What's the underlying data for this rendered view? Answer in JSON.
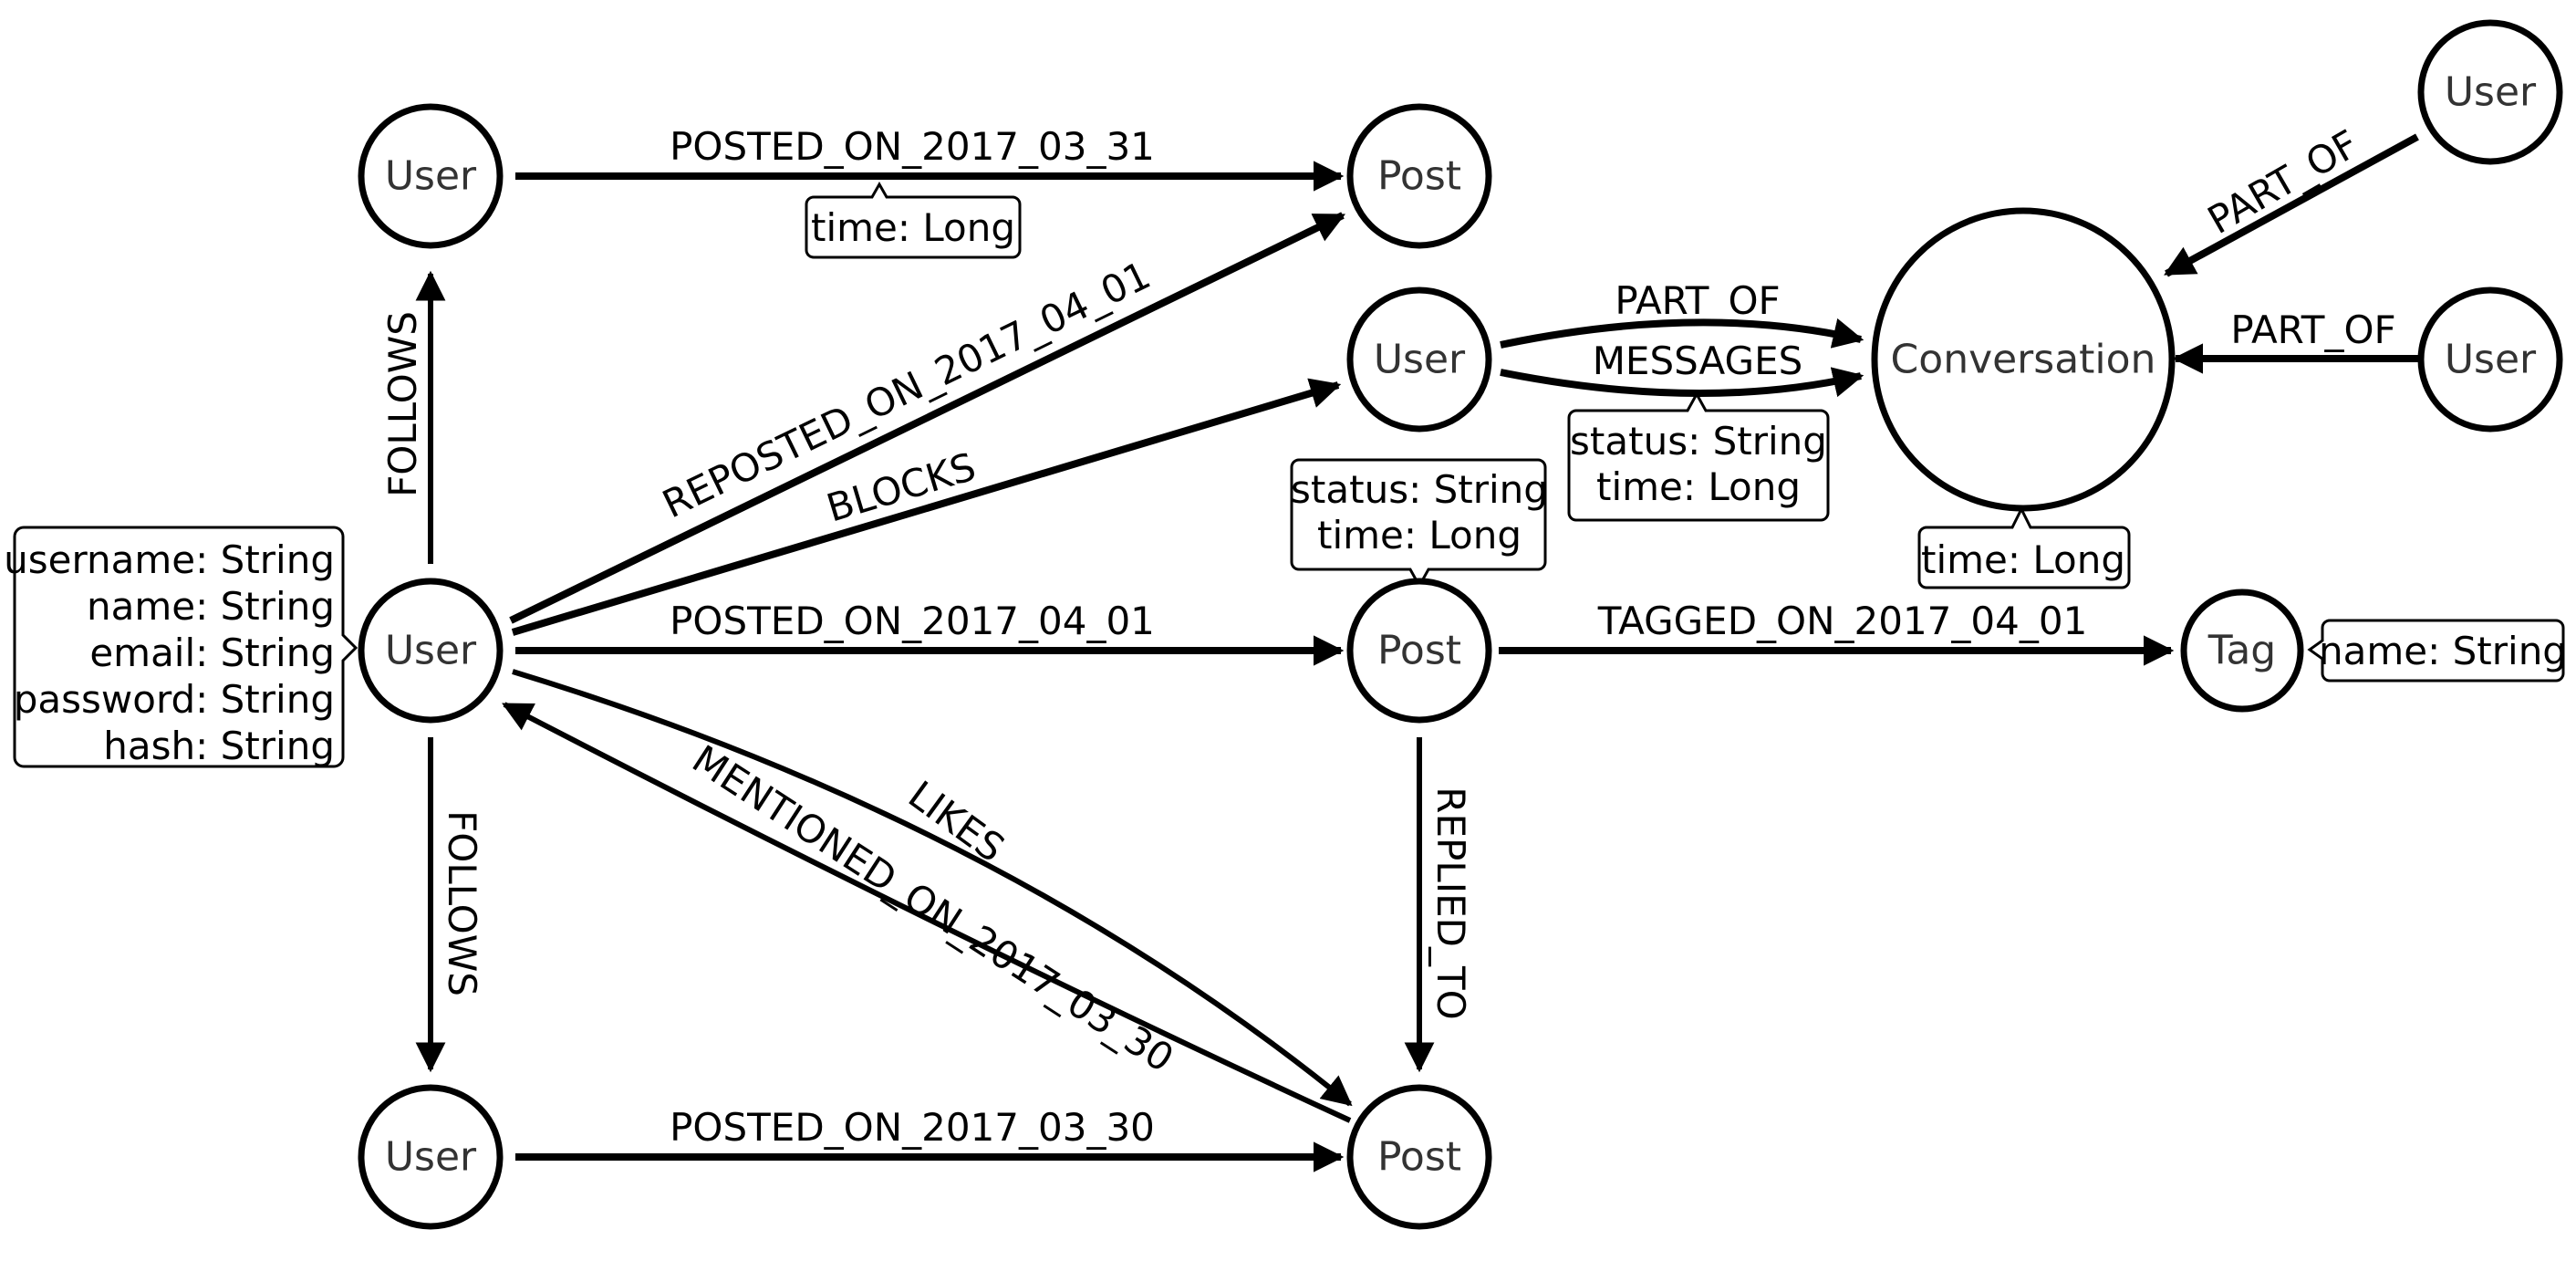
{
  "nodes": [
    {
      "id": "u_top",
      "label": "User",
      "cx": 0.1671,
      "cy": 0.1393
    },
    {
      "id": "p_top",
      "label": "Post",
      "cx": 0.551,
      "cy": 0.1393
    },
    {
      "id": "u_mid",
      "label": "User",
      "cx": 0.551,
      "cy": 0.2852
    },
    {
      "id": "conv",
      "label": "Conversation",
      "cx": 0.7857,
      "cy": 0.2852,
      "big": true
    },
    {
      "id": "u_tr",
      "label": "User",
      "cx": 0.9668,
      "cy": 0.0729
    },
    {
      "id": "u_r",
      "label": "User",
      "cx": 0.9668,
      "cy": 0.2852
    },
    {
      "id": "u_main",
      "label": "User",
      "cx": 0.1671,
      "cy": 0.5156
    },
    {
      "id": "p_mid",
      "label": "Post",
      "cx": 0.551,
      "cy": 0.5156
    },
    {
      "id": "tag",
      "label": "Tag",
      "cx": 0.8705,
      "cy": 0.5156,
      "small": true
    },
    {
      "id": "u_bot",
      "label": "User",
      "cx": 0.1671,
      "cy": 0.9167
    },
    {
      "id": "p_bot",
      "label": "Post",
      "cx": 0.551,
      "cy": 0.9167
    }
  ],
  "edges": [
    {
      "id": "e1",
      "label": "POSTED_ON_2017_03_31",
      "from": "u_top",
      "to": "p_top"
    },
    {
      "id": "e2",
      "label": "FOLLOWS",
      "from": "u_main",
      "to": "u_top"
    },
    {
      "id": "e3",
      "label": "REPOSTED_ON_2017_04_01",
      "from": "u_main",
      "to": "p_top"
    },
    {
      "id": "e4",
      "label": "BLOCKS",
      "from": "u_main",
      "to": "u_mid"
    },
    {
      "id": "e5",
      "label": "PART_OF",
      "from": "u_mid",
      "to": "conv"
    },
    {
      "id": "e6",
      "label": "MESSAGES",
      "from": "u_mid",
      "to": "conv"
    },
    {
      "id": "e7",
      "label": "PART_OF",
      "from": "u_tr",
      "to": "conv"
    },
    {
      "id": "e8",
      "label": "PART_OF",
      "from": "u_r",
      "to": "conv"
    },
    {
      "id": "e9",
      "label": "POSTED_ON_2017_04_01",
      "from": "u_main",
      "to": "p_mid"
    },
    {
      "id": "e10",
      "label": "TAGGED_ON_2017_04_01",
      "from": "p_mid",
      "to": "tag"
    },
    {
      "id": "e11",
      "label": "FOLLOWS",
      "from": "u_main",
      "to": "u_bot"
    },
    {
      "id": "e12",
      "label": "LIKES",
      "from": "u_main",
      "to": "p_bot"
    },
    {
      "id": "e13",
      "label": "MENTIONED_ON_2017_03_30",
      "from": "p_bot",
      "to": "u_main"
    },
    {
      "id": "e14",
      "label": "REPLIED_TO",
      "from": "p_mid",
      "to": "p_bot"
    },
    {
      "id": "e15",
      "label": "POSTED_ON_2017_03_30",
      "from": "u_bot",
      "to": "p_bot"
    }
  ],
  "properties": {
    "user_main": [
      "username: String",
      "name: String",
      "email: String",
      "password: String",
      "hash: String"
    ],
    "posted_0331": [
      "time: Long"
    ],
    "messages": [
      "status: String",
      "time: Long"
    ],
    "post_mid": [
      "status: String",
      "time: Long"
    ],
    "conversation": [
      "time: Long"
    ],
    "tag": [
      "name: String"
    ]
  }
}
